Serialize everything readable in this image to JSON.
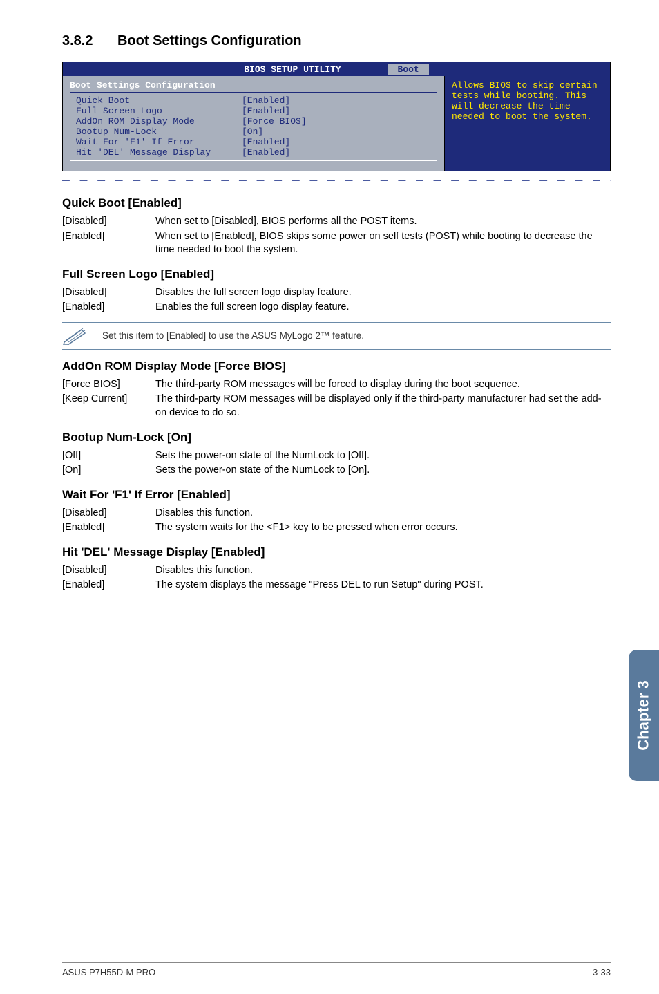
{
  "section": {
    "number": "3.8.2",
    "title": "Boot Settings Configuration"
  },
  "bios": {
    "util_title": "BIOS SETUP UTILITY",
    "tab": "Boot",
    "panel_title": "Boot Settings Configuration",
    "rows": [
      {
        "k": "Quick Boot",
        "v": "[Enabled]"
      },
      {
        "k": "Full Screen Logo",
        "v": "[Enabled]"
      },
      {
        "k": "AddOn ROM Display Mode",
        "v": "[Force BIOS]"
      },
      {
        "k": "Bootup Num-Lock",
        "v": "[On]"
      },
      {
        "k": "Wait For 'F1' If Error",
        "v": "[Enabled]"
      },
      {
        "k": "Hit 'DEL' Message Display",
        "v": "[Enabled]"
      }
    ],
    "help": "Allows BIOS to skip certain tests while booting. This will decrease the time needed to boot the system."
  },
  "subsections": [
    {
      "heading": "Quick Boot [Enabled]",
      "defs": [
        {
          "term": "[Disabled]",
          "desc": "When set to [Disabled], BIOS performs all the POST items."
        },
        {
          "term": "[Enabled]",
          "desc": "When set to [Enabled], BIOS skips some power on self tests (POST) while booting to decrease the time needed to boot the system."
        }
      ]
    },
    {
      "heading": "Full Screen Logo [Enabled]",
      "defs": [
        {
          "term": "[Disabled]",
          "desc": "Disables the full screen logo display feature."
        },
        {
          "term": "[Enabled]",
          "desc": "Enables the full screen logo display feature."
        }
      ],
      "note": "Set this item to [Enabled] to use the ASUS MyLogo 2™ feature."
    },
    {
      "heading": "AddOn ROM Display Mode [Force BIOS]",
      "defs": [
        {
          "term": "[Force BIOS]",
          "desc": "The third-party ROM messages will be forced to display during the boot sequence."
        },
        {
          "term": "[Keep Current]",
          "desc": "The third-party ROM messages will be displayed only if the third-party manufacturer had set the add-on device to do so."
        }
      ]
    },
    {
      "heading": "Bootup Num-Lock [On]",
      "defs": [
        {
          "term": "[Off]",
          "desc": "Sets the power-on state of the NumLock to [Off]."
        },
        {
          "term": "[On]",
          "desc": "Sets the power-on state of the NumLock to [On]."
        }
      ]
    },
    {
      "heading": "Wait For 'F1' If Error [Enabled]",
      "defs": [
        {
          "term": "[Disabled]",
          "desc": "Disables this function."
        },
        {
          "term": "[Enabled]",
          "desc": "The system waits for the <F1> key to be pressed when error occurs."
        }
      ]
    },
    {
      "heading": "Hit 'DEL' Message Display [Enabled]",
      "defs": [
        {
          "term": "[Disabled]",
          "desc": "Disables this function."
        },
        {
          "term": "[Enabled]",
          "desc": "The system displays the message \"Press DEL to run Setup\" during POST."
        }
      ]
    }
  ],
  "side_tab": "Chapter 3",
  "footer": {
    "left": "ASUS P7H55D-M PRO",
    "right": "3-33"
  },
  "dashes": "— — — — — — — — — — — — — — — — — — — — — — — — — — — — — — — — — — — — — — — — —"
}
